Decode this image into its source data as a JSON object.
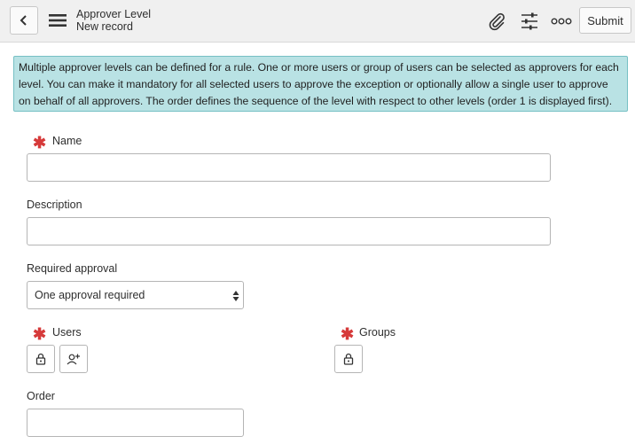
{
  "header": {
    "title": "Approver Level",
    "subtitle": "New record",
    "submit_label": "Submit"
  },
  "info": {
    "text": "Multiple approver levels can be defined for a rule. One or more users or group of users can be selected as approvers for each level. You can make it mandatory for all selected users to approve the exception or optionally allow a single user to approve on behalf of all approvers. The order defines the sequence of the level with respect to other levels (order 1 is displayed first)."
  },
  "form": {
    "name_label": "Name",
    "name_value": "",
    "description_label": "Description",
    "description_value": "",
    "required_approval_label": "Required approval",
    "required_approval_value": "One approval required",
    "users_label": "Users",
    "groups_label": "Groups",
    "order_label": "Order",
    "order_value": "",
    "required_marker": "✱"
  },
  "icons": [
    "chevron-left-icon",
    "hamburger-menu-icon",
    "paperclip-icon",
    "sliders-icon",
    "more-options-icon",
    "lock-icon",
    "add-user-icon"
  ],
  "colors": {
    "header_bg": "#f0f0f0",
    "info_bg": "#b9e2e4",
    "info_border": "#76c0c4",
    "required": "#d63a3a"
  }
}
